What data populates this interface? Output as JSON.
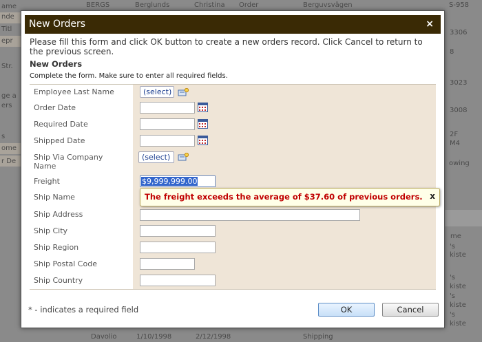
{
  "background": {
    "top_row": [
      "BERGS",
      "Berglunds",
      "Christina",
      "Order",
      "Berguvsvägen",
      "S-958"
    ],
    "left_fragments": [
      "ame",
      "nde",
      "Titl",
      "epr",
      "Str.",
      "ge a",
      "ers",
      "s",
      "ome",
      "r De"
    ],
    "right_fragments": [
      "3306",
      "8",
      "3023",
      "3008",
      "2F",
      "M4",
      "owing",
      "me",
      "'s",
      "kiste",
      "'s",
      "kiste",
      "'s",
      "kiste",
      "'s",
      "kiste"
    ],
    "bottom_row": [
      "Davolio",
      "1/10/1998",
      "2/12/1998",
      "Shipping"
    ]
  },
  "dialog": {
    "title": "New Orders",
    "close": "×",
    "intro": "Please fill this form and click OK button to create a new orders record. Click Cancel to return to the previous screen.",
    "heading": "New Orders",
    "description": "Complete the form. Make sure to enter all required fields.",
    "fields": {
      "employee_last_name": {
        "label": "Employee Last Name",
        "value": "(select)"
      },
      "order_date": {
        "label": "Order Date",
        "value": ""
      },
      "required_date": {
        "label": "Required Date",
        "value": ""
      },
      "shipped_date": {
        "label": "Shipped Date",
        "value": ""
      },
      "ship_via": {
        "label": "Ship Via Company Name",
        "value": "(select)"
      },
      "freight": {
        "label": "Freight",
        "value": "$9,999,999.00"
      },
      "ship_name": {
        "label": "Ship Name",
        "value": ""
      },
      "ship_address": {
        "label": "Ship Address",
        "value": ""
      },
      "ship_city": {
        "label": "Ship City",
        "value": ""
      },
      "ship_region": {
        "label": "Ship Region",
        "value": ""
      },
      "ship_postal_code": {
        "label": "Ship Postal Code",
        "value": ""
      },
      "ship_country": {
        "label": "Ship Country",
        "value": ""
      }
    },
    "tooltip": {
      "message": "The freight exceeds the average of $37.60 of previous orders.",
      "close": "x"
    },
    "required_note": "* - indicates a required field",
    "ok_label": "OK",
    "cancel_label": "Cancel"
  },
  "icons": [
    "lookup-icon",
    "calendar-icon"
  ],
  "colors": {
    "titlebar": "#3a2a05",
    "field_bg": "#efe5d7",
    "error_text": "#c00000",
    "select_text": "#1a3d8f"
  }
}
